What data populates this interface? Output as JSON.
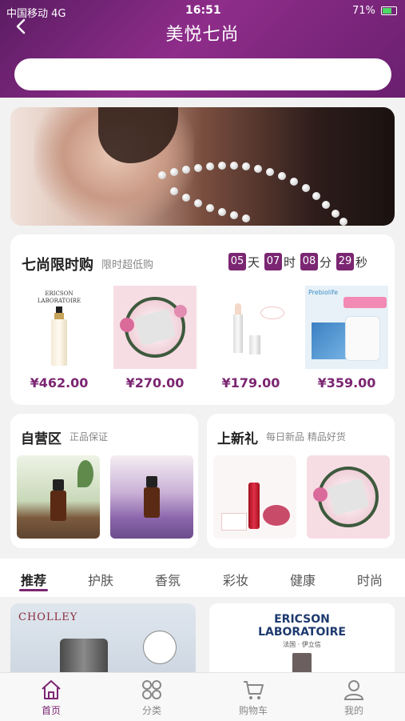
{
  "status": {
    "carrier": "中国移动  4G",
    "time": "16:51",
    "battery": "71%"
  },
  "header": {
    "back_glyph": "‹",
    "title": "美悦七尚",
    "search_placeholder": ""
  },
  "flash_sale": {
    "title": "七尚限时购",
    "subtitle": "限时超低购",
    "countdown": {
      "days": "05",
      "days_unit": "天",
      "hours": "07",
      "hours_unit": "时",
      "minutes": "08",
      "minutes_unit": "分",
      "seconds": "29",
      "seconds_unit": "秒"
    },
    "products": [
      {
        "price": "¥462.00",
        "brand": "ERICSON",
        "brand2": "LABORATOIRE"
      },
      {
        "price": "¥270.00"
      },
      {
        "price": "¥179.00"
      },
      {
        "price": "¥359.00",
        "badge": "Prebiolife"
      }
    ]
  },
  "self_run": {
    "title": "自营区",
    "subtitle": "正品保证"
  },
  "new_gift": {
    "title": "上新礼",
    "subtitle": "每日新品  精品好货"
  },
  "tabs": [
    "推荐",
    "护肤",
    "香氛",
    "彩妆",
    "健康",
    "时尚"
  ],
  "recommend": [
    {
      "brand": "CHOLLEY"
    },
    {
      "brand": "ERICSON",
      "brand2": "LABORATOIRE",
      "sub": "法国 · 伊立信"
    }
  ],
  "nav": [
    "首页",
    "分类",
    "购物车",
    "我的"
  ],
  "colors": {
    "accent": "#7b2672",
    "header_from": "#5b1c63",
    "header_to": "#8e2d8a"
  }
}
